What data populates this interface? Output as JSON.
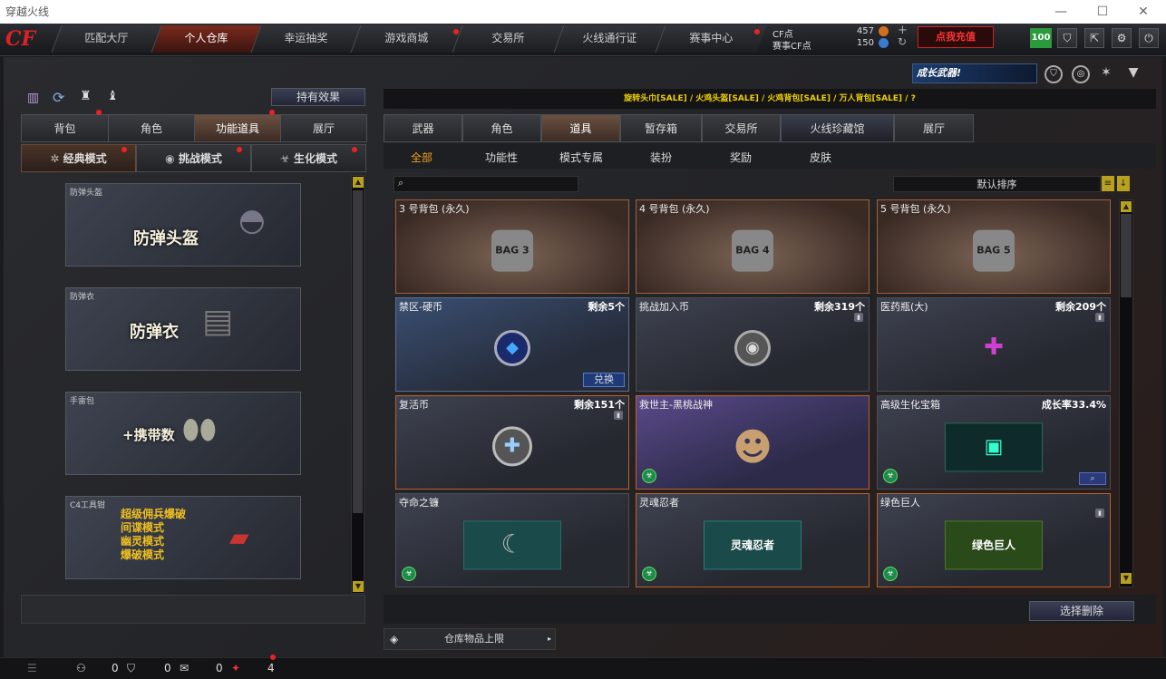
{
  "window": {
    "title": "穿越火线",
    "minimize": "—",
    "maximize": "☐",
    "close": "✕"
  },
  "topnav": {
    "logo": "CF",
    "tabs": [
      {
        "label": "匹配大厅"
      },
      {
        "label": "个人仓库"
      },
      {
        "label": "幸运抽奖"
      },
      {
        "label": "游戏商城"
      },
      {
        "label": "交易所"
      },
      {
        "label": "火线通行证"
      },
      {
        "label": "赛事中心"
      }
    ],
    "cf_label": "CF点",
    "cf_value": "457",
    "match_label": "赛事CF点",
    "match_value": "150",
    "recharge": "点我充值",
    "level": "100"
  },
  "banner": {
    "text": "成长武器!"
  },
  "left": {
    "effect_btn": "持有效果",
    "tabs": [
      {
        "label": "背包"
      },
      {
        "label": "角色"
      },
      {
        "label": "功能道具"
      },
      {
        "label": "展厅"
      }
    ],
    "modes": [
      {
        "label": "经典模式"
      },
      {
        "label": "挑战模式"
      },
      {
        "label": "生化模式"
      }
    ],
    "cards": [
      {
        "tag": "防弹头盔",
        "big": "防弹头盔"
      },
      {
        "tag": "防弹衣",
        "big": "防弹衣"
      },
      {
        "tag": "手雷包",
        "big": "+携带数"
      },
      {
        "tag": "C4工具钳",
        "lines": [
          "超级佣兵爆破",
          "间谍模式",
          "幽灵模式",
          "爆破模式"
        ]
      }
    ]
  },
  "right": {
    "breadcrumb": "旋转头巾[SALE] / 火鸡头盔[SALE] / 火鸡背包[SALE] / 万人背包[SALE] / ?",
    "tabs": [
      {
        "label": "武器"
      },
      {
        "label": "角色"
      },
      {
        "label": "道具"
      },
      {
        "label": "暂存箱"
      },
      {
        "label": "交易所"
      },
      {
        "label": "火线珍藏馆"
      },
      {
        "label": "展厅"
      }
    ],
    "subtabs": [
      {
        "label": "全部"
      },
      {
        "label": "功能性"
      },
      {
        "label": "模式专属"
      },
      {
        "label": "装扮"
      },
      {
        "label": "奖励"
      },
      {
        "label": "皮肤"
      }
    ],
    "sort": "默认排序",
    "items": [
      {
        "name": "3 号背包 (永久)",
        "count": "",
        "pic": "BAG 3",
        "style": "brown"
      },
      {
        "name": "4 号背包 (永久)",
        "count": "",
        "pic": "BAG 4",
        "style": "brown"
      },
      {
        "name": "5 号背包 (永久)",
        "count": "",
        "pic": "BAG 5",
        "style": "brown"
      },
      {
        "name": "禁区-硬币",
        "count": "剩余5个",
        "pic": "◆",
        "style": "blue",
        "action": "兑换"
      },
      {
        "name": "挑战加入币",
        "count": "剩余319个",
        "pic": "◉",
        "style": "plain"
      },
      {
        "name": "医药瓶(大)",
        "count": "剩余209个",
        "pic": "✚",
        "style": "plain"
      },
      {
        "name": "复活币",
        "count": "剩余151个",
        "pic": "✚",
        "style": "orange"
      },
      {
        "name": "救世主-黑桃战神",
        "count": "",
        "pic": "☻",
        "style": "purple"
      },
      {
        "name": "高级生化宝箱",
        "count": "成长率33.4%",
        "pic": "▣",
        "style": "plain"
      },
      {
        "name": "夺命之镰",
        "count": "",
        "pic": "☾",
        "style": "plain"
      },
      {
        "name": "灵魂忍者",
        "count": "",
        "pic": "灵魂忍者",
        "style": "orange"
      },
      {
        "name": "绿色巨人",
        "count": "",
        "pic": "绿色巨人",
        "style": "orange"
      }
    ],
    "delete_btn": "选择删除",
    "storage": "仓库物品上限"
  },
  "status": {
    "c1": "0",
    "c2": "0",
    "c3": "0",
    "c4": "4"
  }
}
